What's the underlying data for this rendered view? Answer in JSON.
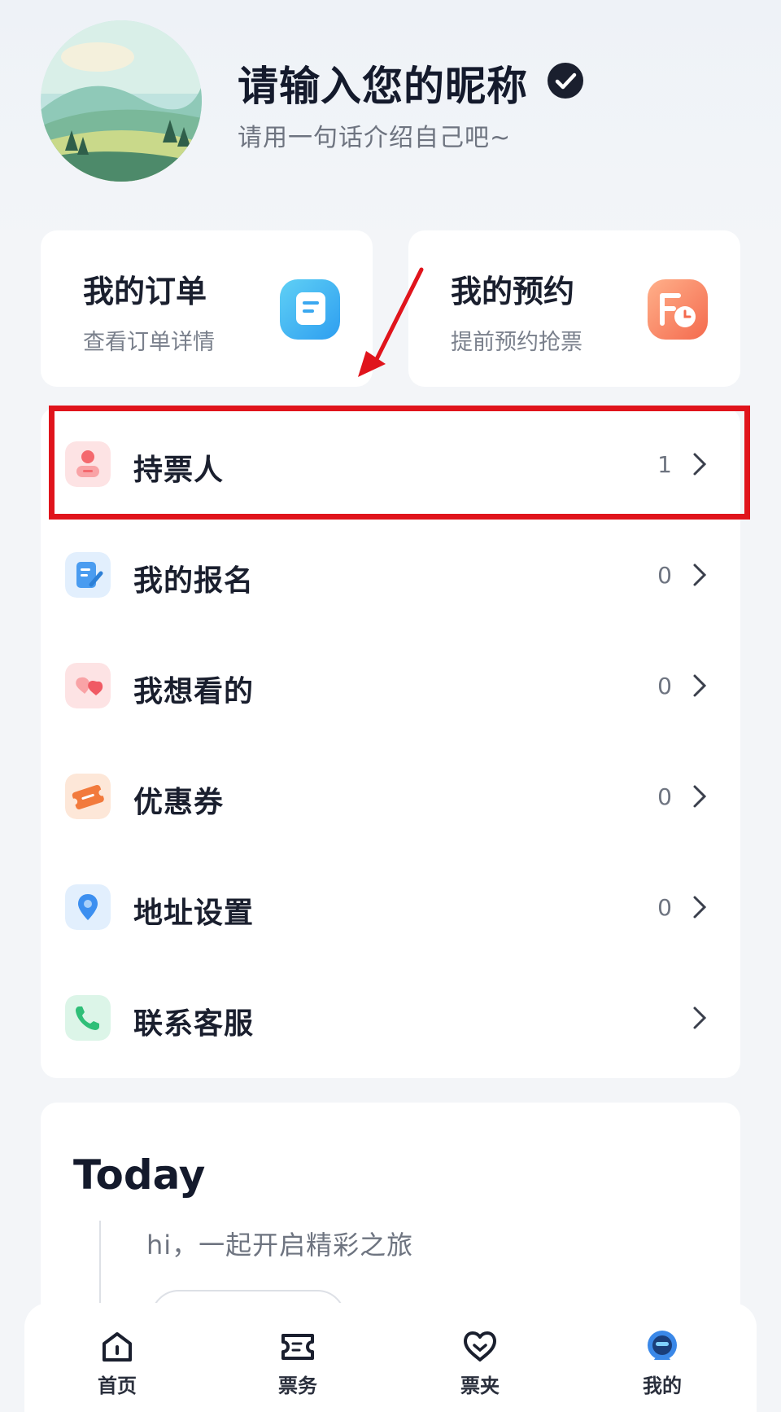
{
  "profile": {
    "nickname": "请输入您的昵称",
    "bio": "请用一句话介绍自己吧~"
  },
  "cards": {
    "orders": {
      "title": "我的订单",
      "subtitle": "查看订单详情",
      "icon": "order-list-icon"
    },
    "reserve": {
      "title": "我的预约",
      "subtitle": "提前预约抢票",
      "icon": "calendar-clock-icon"
    }
  },
  "menu": {
    "items": [
      {
        "label": "持票人",
        "count": "1",
        "icon": "ticket-holder-icon",
        "color": "#f4696e"
      },
      {
        "label": "我的报名",
        "count": "0",
        "icon": "signup-form-icon",
        "color": "#4a9cf0"
      },
      {
        "label": "我想看的",
        "count": "0",
        "icon": "heart-icon",
        "color": "#f05a64"
      },
      {
        "label": "优惠券",
        "count": "0",
        "icon": "coupon-icon",
        "color": "#f27a3c"
      },
      {
        "label": "地址设置",
        "count": "0",
        "icon": "location-pin-icon",
        "color": "#3c8ff0"
      },
      {
        "label": "联系客服",
        "count": "",
        "icon": "phone-icon",
        "color": "#2fbf78"
      }
    ]
  },
  "today": {
    "title": "Today",
    "text": "hi，一起开启精彩之旅"
  },
  "nav": {
    "items": [
      {
        "label": "首页",
        "icon": "home-icon"
      },
      {
        "label": "票务",
        "icon": "ticket-icon"
      },
      {
        "label": "票夹",
        "icon": "heart-outline-icon"
      },
      {
        "label": "我的",
        "icon": "profile-icon"
      }
    ]
  },
  "annotation": {
    "color": "#e0141c"
  }
}
